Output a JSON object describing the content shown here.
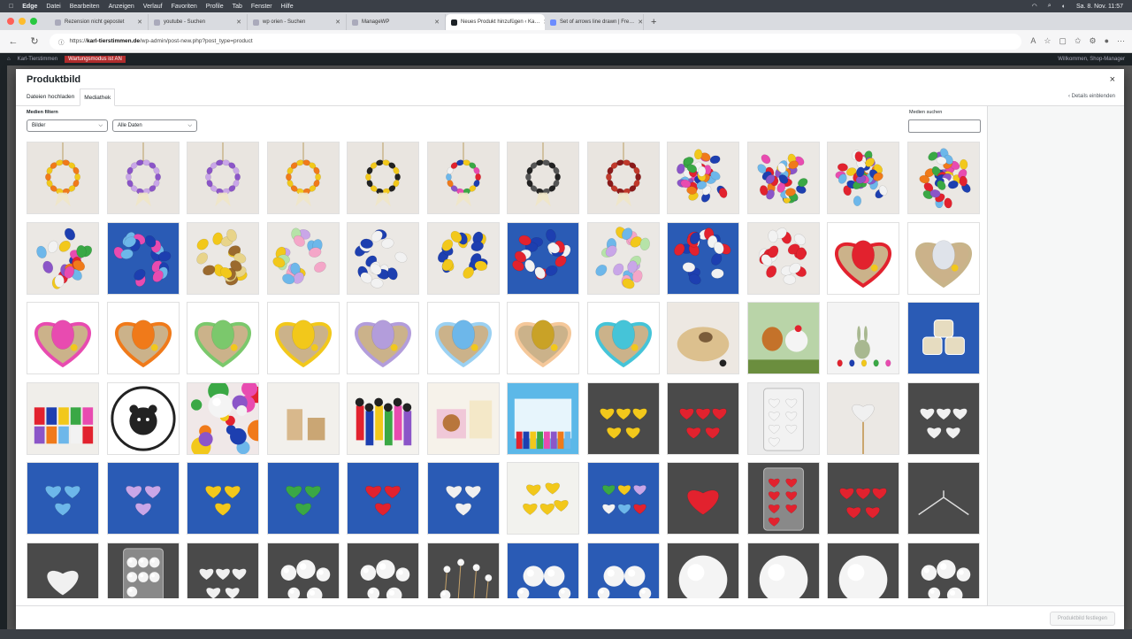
{
  "menubar": {
    "app": "Edge",
    "items": [
      "Datei",
      "Bearbeiten",
      "Anzeigen",
      "Verlauf",
      "Favoriten",
      "Profile",
      "Tab",
      "Fenster",
      "Hilfe"
    ],
    "datetime": "Sa. 8. Nov. 11:57"
  },
  "tabs": [
    {
      "label": "Rezension nicht gepostet"
    },
    {
      "label": "youtube - Suchen"
    },
    {
      "label": "wp orien - Suchen"
    },
    {
      "label": "ManageWP"
    },
    {
      "label": "Neues Produkt hinzufügen ‹ Ka…"
    },
    {
      "label": "Set of arrows line drawn | Fre…"
    }
  ],
  "active_tab_index": 4,
  "address": {
    "prefix": "https://",
    "host": "karl-tierstimmen.de",
    "path": "/wp-admin/post-new.php?post_type=product"
  },
  "wpbar": {
    "site": "Karl-Tierstimmen",
    "maintenance": "Wartungsmodus ist AN",
    "howdy": "Willkommen, Shop-Manager"
  },
  "modal": {
    "title": "Produktbild",
    "close": "×",
    "tabs": [
      {
        "label": "Dateien hochladen"
      },
      {
        "label": "Mediathek"
      }
    ],
    "active_tab": 1,
    "details_link": "‹ Details einblenden",
    "filters_label": "Medien filtern",
    "filter_type": "Bilder",
    "filter_date": "Alle Daten",
    "search_label": "Medien suchen",
    "search_value": "",
    "set_button": "Produktbild festlegen"
  },
  "colors": {
    "wp_dark": "#1d2327",
    "grid_grey": "#4a4a4a",
    "tile_blue": "#2a5bb5"
  },
  "media": [
    "wreath-yellow",
    "wreath-purple",
    "wreath-purple",
    "wreath-yellow",
    "wreath-black-yellow",
    "wreath-mixed",
    "wreath-black",
    "wreath-red",
    "eggs-pile",
    "eggs-pile",
    "eggs-pile",
    "eggs-pile",
    "eggs-ring",
    "eggs-pink-blue",
    "eggs-yellow-brown",
    "eggs-pastel",
    "eggs-blue-white",
    "eggs-blue-yellow",
    "eggs-red-blue",
    "eggs-pastel",
    "eggs-red-blue",
    "eggs-red-white",
    "heart-nest-red",
    "heart-nest-white",
    "heart-nest-pink",
    "heart-nest-orange",
    "heart-nest-green",
    "heart-nest-yellow",
    "heart-nest-lavender",
    "heart-nest-lightblue",
    "heart-nest-gold",
    "heart-nest-cyan",
    "nest-bird",
    "chickens",
    "rabbits",
    "clear-cylinders",
    "toy-stack",
    "logo-bear",
    "balls-mix",
    "wood-boxes",
    "figures",
    "bear-boxes",
    "toy-pack",
    "hearts-yellow-dark",
    "hearts-red-dark",
    "bag-white",
    "heart-stick-white",
    "hearts-white-dark",
    "hearts-lightblue-blue",
    "hearts-lilac-blue",
    "hearts-yellow-blue",
    "hearts-green-blue",
    "hearts-red-blue",
    "hearts-white-blue",
    "hearts-yellow-light",
    "hearts-mixed-blue",
    "heart-red-dark",
    "bag-red",
    "hearts-red-dark",
    "hanger-dark",
    "heart-white-dark",
    "bag-balls",
    "hearts-white-dark",
    "balls-white-dark",
    "balls-white-dark",
    "balls-sticks-dark",
    "balls-blue",
    "balls-blue",
    "ball-big-dark",
    "ball-big-dark",
    "ball-big-dark",
    "balls-white-dark"
  ]
}
